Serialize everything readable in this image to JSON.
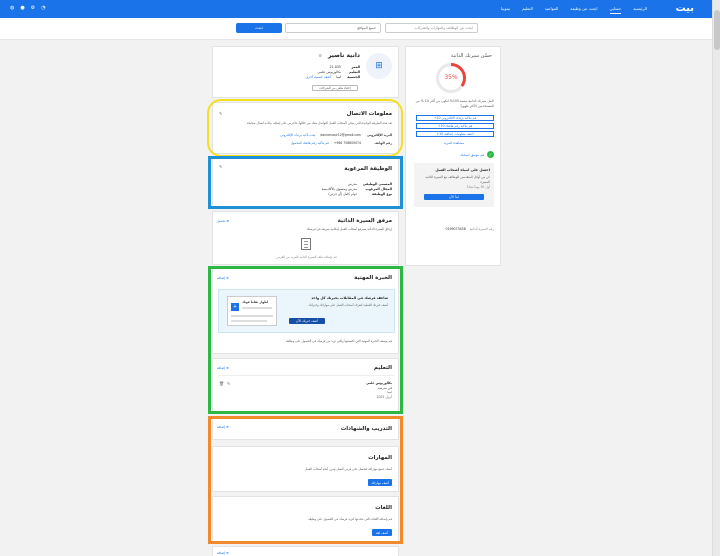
{
  "nav": {
    "logo": "بيت",
    "items": [
      "الرئيسية",
      "حسابي",
      "ابحث عن وظيفة",
      "المواعيد",
      "التعليم",
      "بيتوبيا"
    ],
    "active_index": 1
  },
  "search": {
    "keyword_placeholder": "ابحث عن الوظائف والمهارات والشركات",
    "location_value": "جميع المواقع",
    "button_label": "ابحث"
  },
  "sidebar": {
    "title": "حسّن سيرتك الذاتية",
    "percent_text": "35%",
    "percent_value": 35,
    "tip": "اكمل سيرتك الذاتية بنسبة 100% لتكون من أكثر 10 % من المستخدمين الأكثر ظهوراً",
    "actions": [
      "قم بتأكيد بريدك الالكتروني 10+",
      "قم بتأكيد رقم هاتفك 10+",
      "أضف معلومات إضافية 10+"
    ],
    "more_link": "مشاهدة المزيد",
    "verified_title": "قم بتوثيق حسابك",
    "promo_title": "احصل على انتباه أصحاب العمل",
    "promo_text": "كن من أوائل المتقدمين للوظائف مع السيرة الذاتية المميزة",
    "promo_sub": "أول 30 يوماً مجاناً",
    "promo_button": "ابدأ الآن",
    "resume_id_label": "رقم السيرة الذاتية",
    "resume_id": "0199073458"
  },
  "profile": {
    "name": "دانية ناصير",
    "age_label": "العمر",
    "age_value": "21.035",
    "education_label": "التعليم",
    "education_value": "بكالوريوس علمي",
    "nationality_label": "الجنسية",
    "nationality_value": "ليبيا",
    "nationality_link": "أضف جنسية أخرى",
    "visibility_button": "إخفاء ملفي من الشركات"
  },
  "contact": {
    "title": "معلومات الاتصال",
    "desc": "تعد هذه الطريقة الوحيدة التي يمكن لأصحاب العمل التواصل معك من خلالها، فاحرص على إضافة بيانات اتصال صحيحة",
    "email_label": "البريد الإلكتروني",
    "email_value": "daniarnasir12@gmail.com",
    "email_link": "يجب تأكيد بريدك الإلكتروني",
    "phone_label": "رقم الهاتف",
    "phone_value": "+966 758800074",
    "phone_link": "قم بتأكيد رقم هاتفك المحمول"
  },
  "job": {
    "title": "الوظيفة المرغوبة",
    "rows": [
      {
        "label": "المسمى الوظيفي",
        "value": "مدرس"
      },
      {
        "label": "المجال المرغوب",
        "value": "مدرس ومسوق بالأكاديمية"
      },
      {
        "label": "نوع الوظيفة",
        "value": "دوام كامل (أو جزئي)"
      }
    ]
  },
  "attachment": {
    "title": "مرفق السيرة الذاتية",
    "add_label": "تحميل",
    "desc": "إرفاق السيرة الذاتية سيرفع أصحاب العمل إمكانية سريعة في فرصتك",
    "note": "قم بإضافة ملف السيرة الذاتية للمزيد من الفرص"
  },
  "experience": {
    "title": "الخبرة المهنية",
    "add_label": "إضافة",
    "promo_title": "ضاعف فرصك في المقابلات بخبرتك كل واحد",
    "promo_text": "أضف خبرتك العملية لتعرف أصحاب العمل على مهاراتك وخبراتك",
    "promo_button": "أضف خبرتك الآن",
    "promo_badge": "اظهار نقاط قوتك",
    "note": "قم بوصف الخبرة المهنية التي اكتسبتها والتي تزيد من فرصك في الحصول على وظائف"
  },
  "education": {
    "title": "التعليم",
    "add_label": "إضافة",
    "degree": "بكالوريوس علمي",
    "field": "في مدرسة",
    "country": "ليبيا",
    "year": "أبريل 2025"
  },
  "training": {
    "title": "التدريب والشهادات",
    "add_label": "إضافة"
  },
  "skills": {
    "title": "المهارات",
    "desc": "أضف جميع مهاراتك لتحصل على فرص أفضل وتبرز أمام أصحاب العمل",
    "button": "أضف مهاراتك"
  },
  "languages": {
    "title": "اللغات",
    "desc": "قم بإضافة اللغات التي تتحدثها لتزيد فرصك في الحصول على وظيفة",
    "button": "أضف لغة"
  },
  "footer": {
    "add_label": "إضافة"
  },
  "colors": {
    "brand": "#1a73e8",
    "highlight_yellow": "#f5e020",
    "highlight_blue": "#1f8fd6",
    "highlight_green": "#2db843",
    "highlight_orange": "#f08a2c",
    "progress": "#e8453c"
  }
}
